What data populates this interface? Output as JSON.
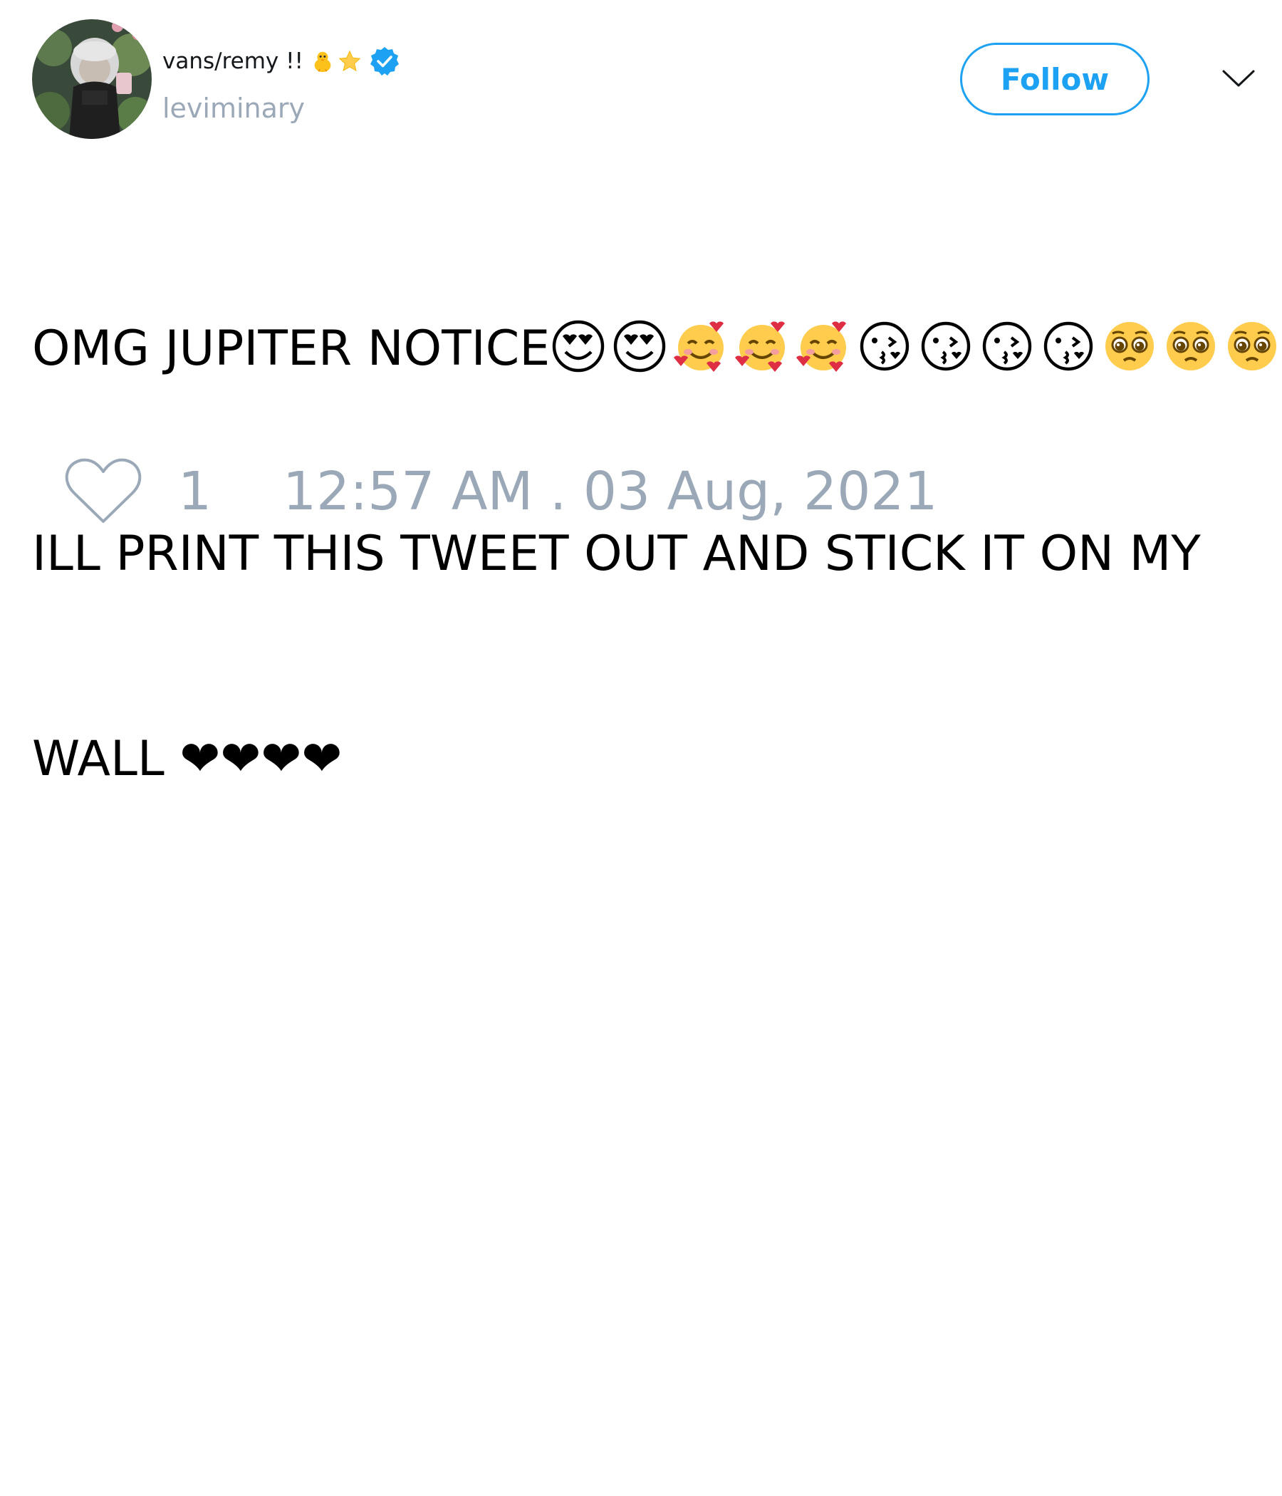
{
  "user": {
    "display_name": "vans/remy !!",
    "name_emojis": [
      "baby-chick",
      "star"
    ],
    "verified": true,
    "handle": "leviminary",
    "avatar": "user-avatar-photo"
  },
  "actions": {
    "follow_label": "Follow",
    "menu_icon": "chevron-down-icon"
  },
  "tweet": {
    "line1_text": "OMG JUPITER NOTICE",
    "line1_emojis": [
      "heart-eyes",
      "heart-eyes",
      "smiling-face-with-hearts",
      "smiling-face-with-hearts",
      "smiling-face-with-hearts",
      "kissing-heart",
      "kissing-heart",
      "kissing-heart",
      "kissing-heart",
      "pleading-face",
      "pleading-face",
      "pleading-face"
    ],
    "line2_text": "ILL PRINT THIS TWEET OUT AND STICK IT ON MY",
    "line3_text": "WALL ❤❤❤❤"
  },
  "footer": {
    "like_icon": "heart-outline-icon",
    "like_count": "1",
    "timestamp": "12:57 AM . 03 Aug, 2021"
  },
  "colors": {
    "accent": "#1da1f2",
    "muted": "#9aa8b8",
    "text": "#000000"
  }
}
